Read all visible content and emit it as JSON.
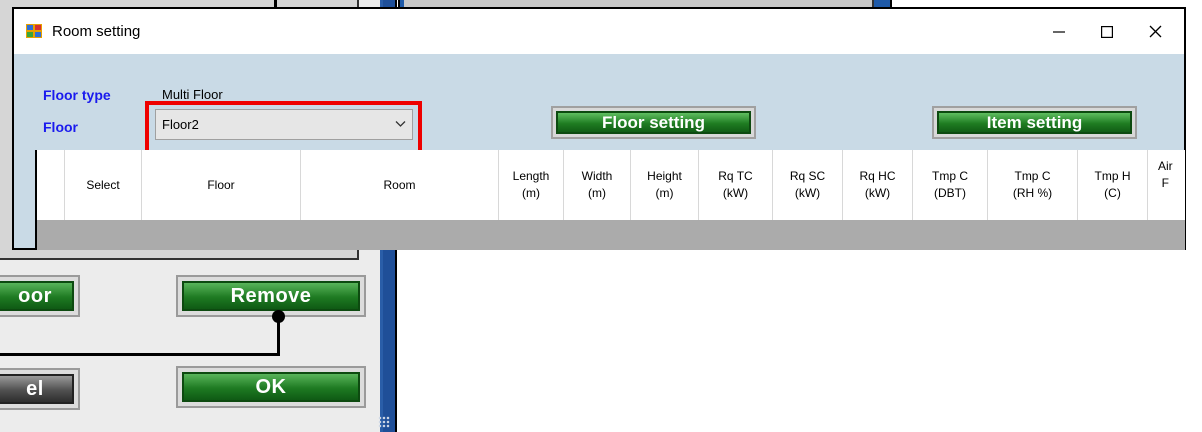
{
  "background_window": {
    "buttons": {
      "add_floor_fragment": "oor",
      "remove": "Remove",
      "cancel_fragment": "el",
      "ok": "OK"
    }
  },
  "dialog": {
    "title": "Room setting",
    "controls": {
      "minimize": "minimize-icon",
      "maximize": "maximize-icon",
      "close": "close-icon"
    },
    "floor_type_label": "Floor type",
    "floor_type_value": "Multi Floor",
    "floor_label": "Floor",
    "floor_select_value": "Floor2",
    "floor_setting_button": "Floor setting",
    "item_setting_button": "Item setting",
    "grid": {
      "columns": [
        "",
        "Select",
        "Floor",
        "Room",
        "Length\n(m)",
        "Width\n(m)",
        "Height\n(m)",
        "Rq TC\n(kW)",
        "Rq SC\n(kW)",
        "Rq HC\n(kW)",
        "Tmp C\n(DBT)",
        "Tmp C\n(RH %)",
        "Tmp H\n(C)",
        "Air\nF"
      ]
    }
  },
  "colors": {
    "dialog_bg": "#c9dae6",
    "label_blue": "#1a1aee",
    "highlight_red": "#ee0000",
    "button_green": "#1e7a22"
  }
}
